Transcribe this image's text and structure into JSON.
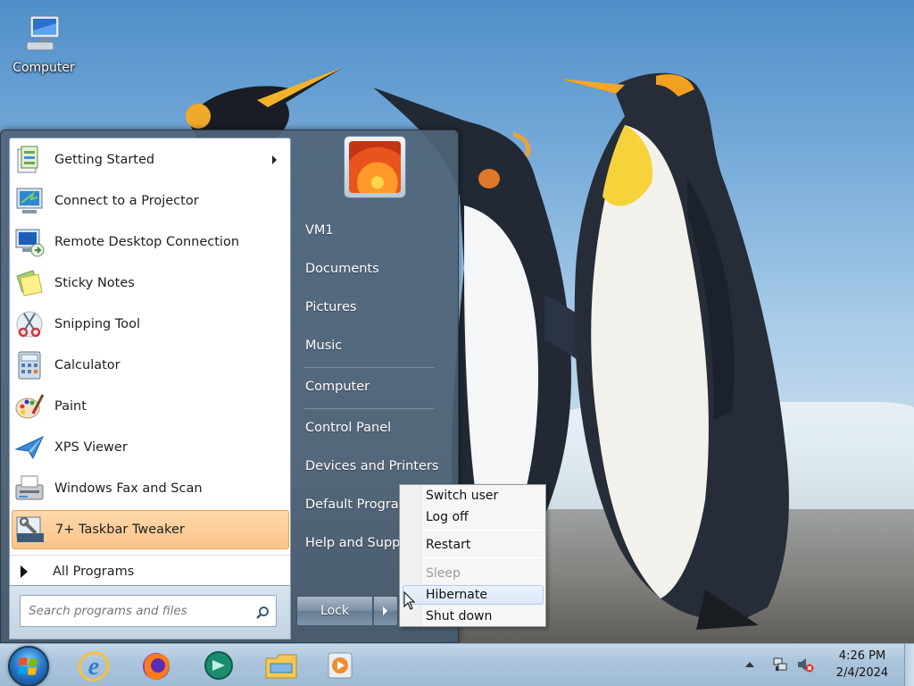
{
  "desktop": {
    "icons": [
      {
        "label": "Computer",
        "icon": "computer-icon"
      }
    ]
  },
  "start_menu": {
    "programs": [
      {
        "label": "Getting Started",
        "icon": "getting-started-icon",
        "has_submenu": true
      },
      {
        "label": "Connect to a Projector",
        "icon": "projector-icon"
      },
      {
        "label": "Remote Desktop Connection",
        "icon": "remote-desktop-icon"
      },
      {
        "label": "Sticky Notes",
        "icon": "sticky-notes-icon"
      },
      {
        "label": "Snipping Tool",
        "icon": "snipping-tool-icon"
      },
      {
        "label": "Calculator",
        "icon": "calculator-icon"
      },
      {
        "label": "Paint",
        "icon": "paint-icon"
      },
      {
        "label": "XPS Viewer",
        "icon": "xps-viewer-icon"
      },
      {
        "label": "Windows Fax and Scan",
        "icon": "fax-scan-icon"
      },
      {
        "label": "7+ Taskbar Tweaker",
        "icon": "taskbar-tweaker-icon",
        "highlighted": true
      }
    ],
    "all_programs_label": "All Programs",
    "search_placeholder": "Search programs and files",
    "right_links": [
      "VM1",
      "Documents",
      "Pictures",
      "Music",
      "Computer",
      "Control Panel",
      "Devices and Printers",
      "Default Programs",
      "Help and Support"
    ],
    "lock_label": "Lock"
  },
  "power_menu": {
    "items": [
      {
        "label": "Switch user"
      },
      {
        "label": "Log off"
      },
      {
        "label": "Restart"
      },
      {
        "label": "Sleep",
        "disabled": true
      },
      {
        "label": "Hibernate",
        "hover": true
      },
      {
        "label": "Shut down"
      }
    ]
  },
  "taskbar": {
    "pinned": [
      "internet-explorer-icon",
      "firefox-icon",
      "chat-app-icon",
      "file-explorer-icon",
      "media-player-icon"
    ],
    "tray": [
      "network-icon",
      "volume-muted-icon"
    ],
    "time": "4:26 PM",
    "date": "2/4/2024"
  },
  "colors": {
    "highlight": "#fbc48a",
    "taskbar": "#aac4dc",
    "menu_blue": "#5a7088"
  }
}
